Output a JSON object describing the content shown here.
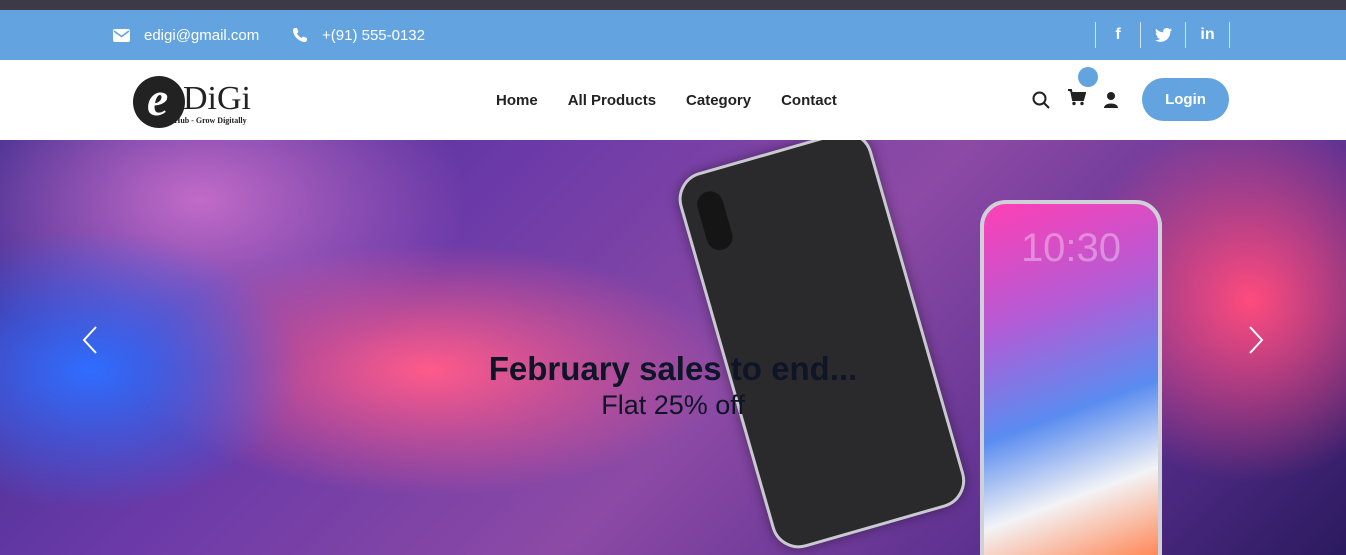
{
  "contact": {
    "email": "edigi@gmail.com",
    "phone": "+(91) 555-0132"
  },
  "socials": [
    {
      "label": "f",
      "icon": "facebook-icon"
    },
    {
      "label": "t",
      "icon": "twitter-icon"
    },
    {
      "label": "in",
      "icon": "linkedin-icon"
    }
  ],
  "logo": {
    "letter": "e",
    "name": "DiGi",
    "tagline": "Digital Hub - Grow Digitally"
  },
  "nav": {
    "items": [
      "Home",
      "All Products",
      "Category",
      "Contact"
    ],
    "login_label": "Login"
  },
  "hero": {
    "title": "February sales to end...",
    "subtitle": "Flat 25% off",
    "phone_time": "10:30"
  },
  "colors": {
    "accent": "#62a3e0",
    "topstrip": "#3d3a48",
    "text_dark": "#0e1526"
  }
}
